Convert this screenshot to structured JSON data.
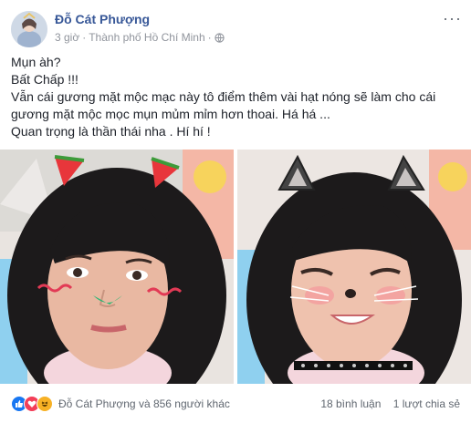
{
  "post": {
    "author": "Đỗ Cát Phượng",
    "time": "3 giờ",
    "separator": "·",
    "location": "Thành phố Hồ Chí Minh",
    "text_lines": [
      "Mụn àh?",
      "Bất Chấp !!!",
      "Vẫn cái gương mặt mộc mạc này tô điểm thêm vài hạt nóng sẽ làm cho cái",
      "gương mặt mộc mọc mụn mủm mỉm hơn thoai. Há há ...",
      "Quan trọng là thần thái nha . Hí hí !"
    ],
    "more_label": "···"
  },
  "footer": {
    "reactions_text": "Đỗ Cát Phượng và 856 người khác",
    "comments": "18 bình luận",
    "shares": "1 lượt chia sẻ",
    "reaction_icons": [
      "like-icon",
      "love-icon",
      "haha-icon"
    ]
  },
  "colors": {
    "link": "#385898",
    "secondary": "#90949c",
    "like": "#1877f2",
    "love": "#f33e58",
    "haha": "#f7b125"
  }
}
